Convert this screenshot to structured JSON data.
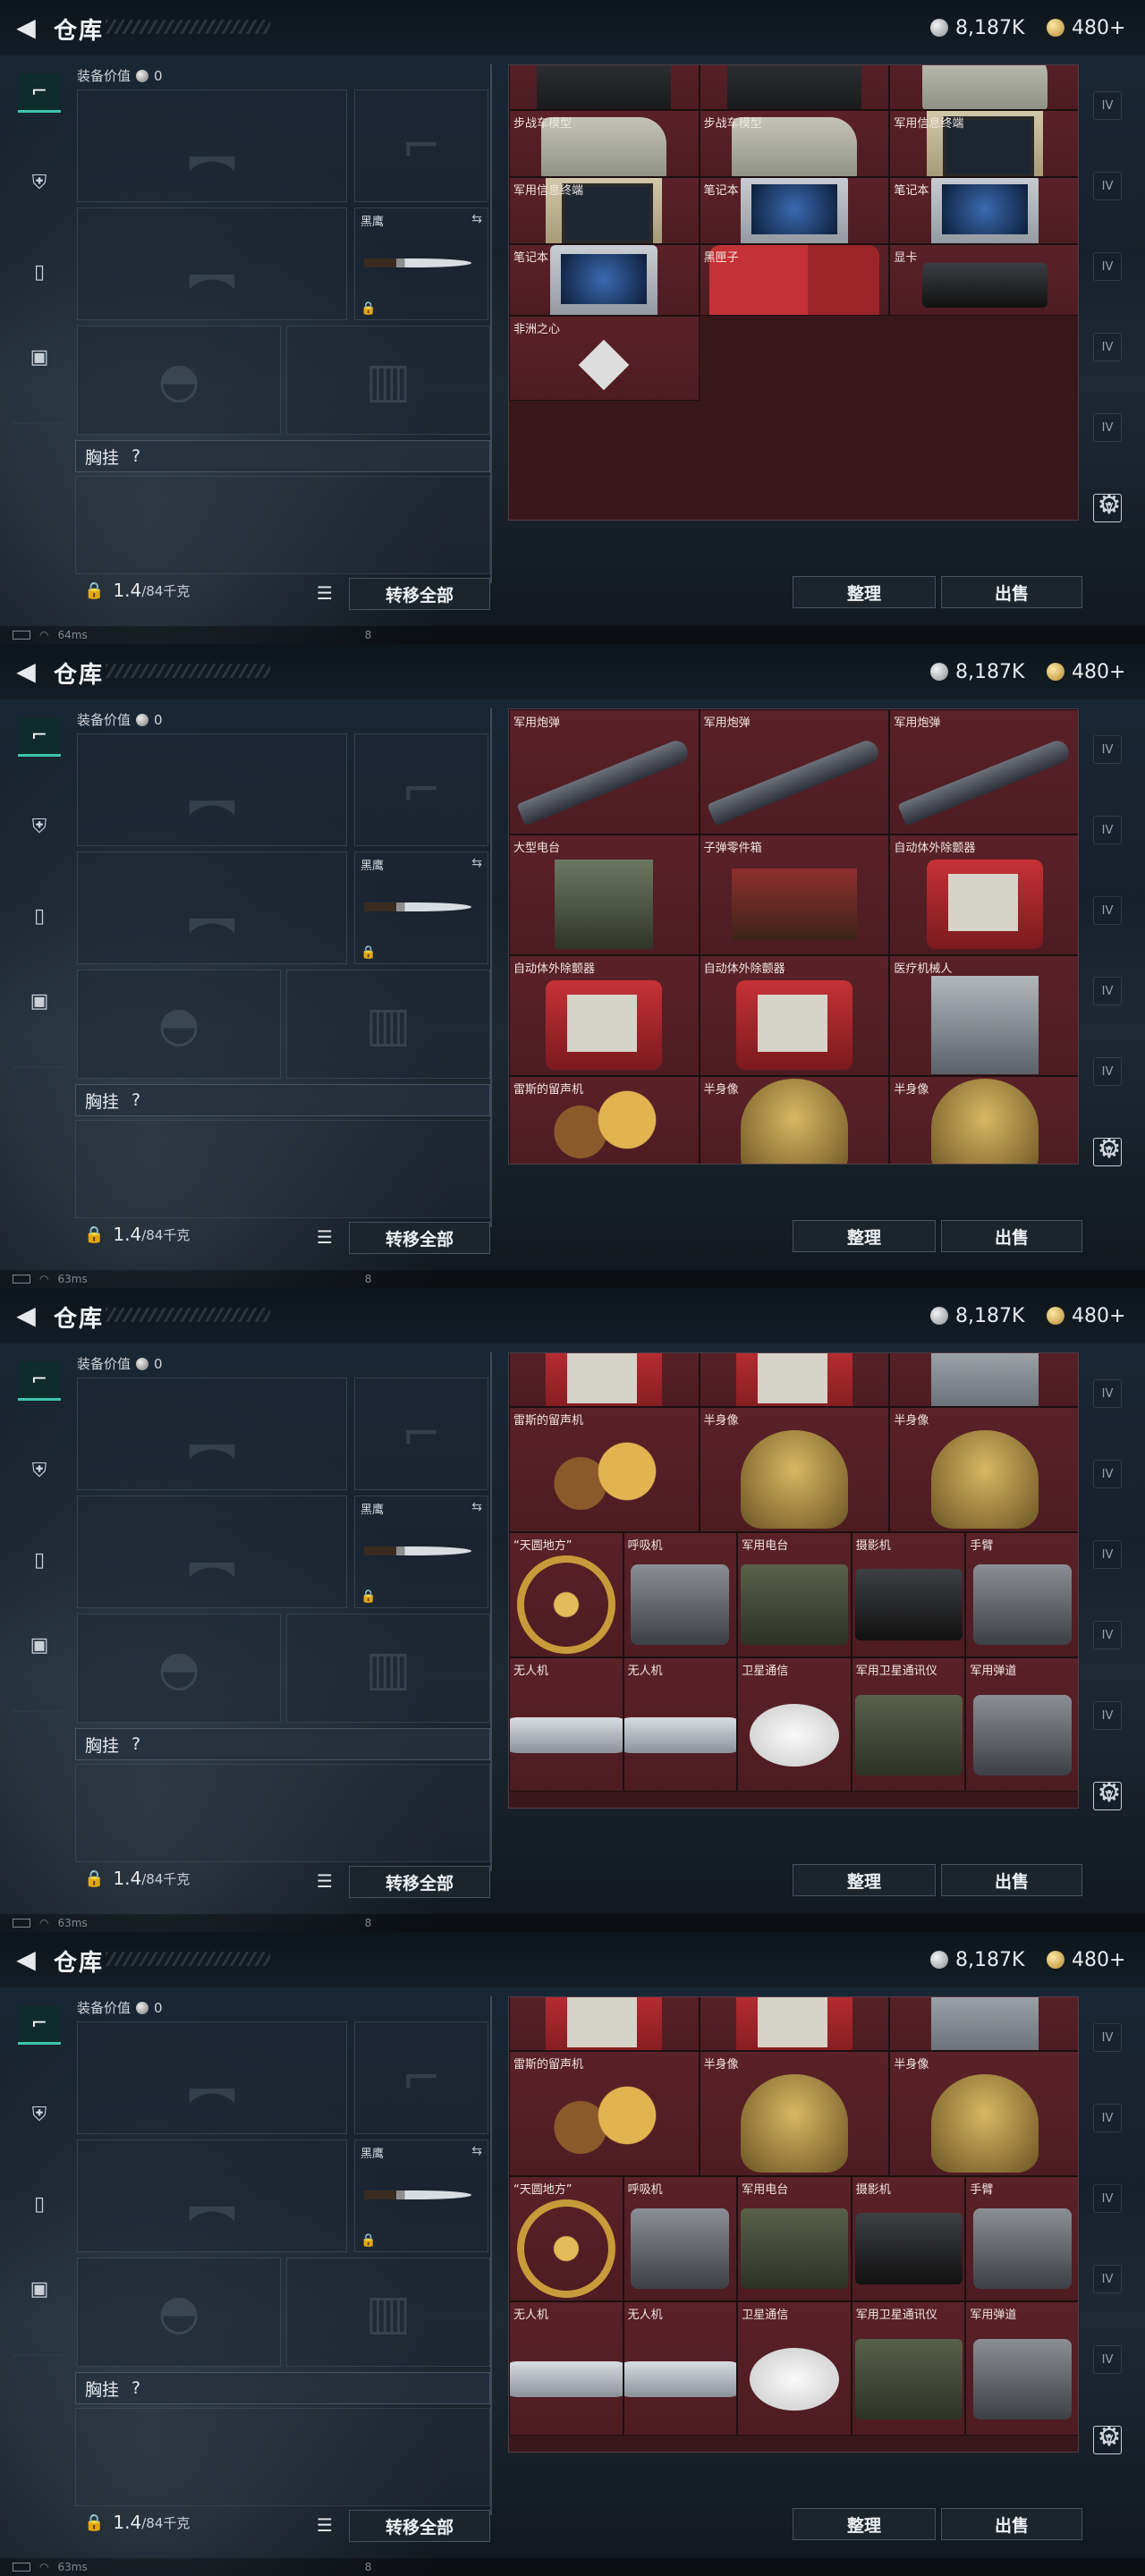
{
  "header": {
    "title": "仓库",
    "silver": "8,187K",
    "gold": "480+"
  },
  "left_nav": {
    "tabs": [
      "weapon-tab",
      "armor-tab",
      "backpack-tab",
      "medkit-tab"
    ]
  },
  "equipment": {
    "value_label": "装备价值",
    "value": "0",
    "melee_label": "黑鹰",
    "chest_label": "胸挂",
    "chest_hint": "?"
  },
  "footer": {
    "weight_value": "1.4",
    "weight_max": "/84千克",
    "transfer_all": "转移全部",
    "sort": "整理",
    "sell": "出售"
  },
  "status_bar": {
    "texts": [
      "64ms",
      "63ms",
      "63ms",
      "63ms"
    ],
    "extra": "8"
  },
  "right_nav": [
    "IV",
    "IV",
    "IV",
    "IV",
    "IV",
    "IV"
  ],
  "screens": [
    {
      "cells": [
        {
          "name": "",
          "art": "printer"
        },
        {
          "name": "",
          "art": "printer"
        },
        {
          "name": "步战车模型",
          "art": "tank"
        },
        {
          "name": "步战车模型",
          "art": "tank"
        },
        {
          "name": "步战车模型",
          "art": "tank"
        },
        {
          "name": "军用信息终端",
          "art": "term"
        },
        {
          "name": "军用信息终端",
          "art": "term"
        },
        {
          "name": "笔记本",
          "art": "laptop"
        },
        {
          "name": "笔记本",
          "art": "laptop"
        },
        {
          "name": "笔记本",
          "art": "laptop"
        },
        {
          "name": "黑匣子",
          "art": "fuel"
        },
        {
          "name": "显卡",
          "art": "gpu"
        },
        {
          "name": "非洲之心",
          "art": "diamond"
        }
      ]
    },
    {
      "cells": [
        {
          "name": "军用炮弹",
          "art": "missile"
        },
        {
          "name": "军用炮弹",
          "art": "missile"
        },
        {
          "name": "军用炮弹",
          "art": "missile"
        },
        {
          "name": "大型电台",
          "art": "cage"
        },
        {
          "name": "子弹零件箱",
          "art": "parts"
        },
        {
          "name": "自动体外除颤器",
          "art": "red"
        },
        {
          "name": "自动体外除颤器",
          "art": "red"
        },
        {
          "name": "自动体外除颤器",
          "art": "red"
        },
        {
          "name": "医疗机械人",
          "art": "rig"
        },
        {
          "name": "雷斯的留声机",
          "art": "gramo"
        },
        {
          "name": "半身像",
          "art": "bust"
        },
        {
          "name": "半身像",
          "art": "bust"
        }
      ]
    },
    {
      "cells": [
        {
          "name": "",
          "art": "red"
        },
        {
          "name": "",
          "art": "red"
        },
        {
          "name": "",
          "art": "rig"
        },
        {
          "name": "雷斯的留声机",
          "art": "gramo"
        },
        {
          "name": "半身像",
          "art": "bust"
        },
        {
          "name": "半身像",
          "art": "bust"
        },
        {
          "name": "“天圆地方”",
          "art": "armillary"
        },
        {
          "name": "呼吸机",
          "art": "generic"
        },
        {
          "name": "军用电台",
          "art": "radio"
        },
        {
          "name": "摄影机",
          "art": "camera"
        },
        {
          "name": "手臂",
          "art": "generic"
        },
        {
          "name": "无人机",
          "art": "drone"
        },
        {
          "name": "无人机",
          "art": "drone"
        },
        {
          "name": "卫星通信",
          "art": "sat"
        },
        {
          "name": "军用卫星通讯仪",
          "art": "radio"
        },
        {
          "name": "军用弹道",
          "art": "generic"
        }
      ]
    },
    {
      "cells": [
        {
          "name": "",
          "art": "red"
        },
        {
          "name": "",
          "art": "red"
        },
        {
          "name": "",
          "art": "rig"
        },
        {
          "name": "雷斯的留声机",
          "art": "gramo"
        },
        {
          "name": "半身像",
          "art": "bust"
        },
        {
          "name": "半身像",
          "art": "bust"
        },
        {
          "name": "“天圆地方”",
          "art": "armillary"
        },
        {
          "name": "呼吸机",
          "art": "generic"
        },
        {
          "name": "军用电台",
          "art": "radio"
        },
        {
          "name": "摄影机",
          "art": "camera"
        },
        {
          "name": "手臂",
          "art": "generic"
        },
        {
          "name": "无人机",
          "art": "drone"
        },
        {
          "name": "无人机",
          "art": "drone"
        },
        {
          "name": "卫星通信",
          "art": "sat"
        },
        {
          "name": "军用卫星通讯仪",
          "art": "radio"
        },
        {
          "name": "军用弹道",
          "art": "generic"
        }
      ]
    }
  ]
}
